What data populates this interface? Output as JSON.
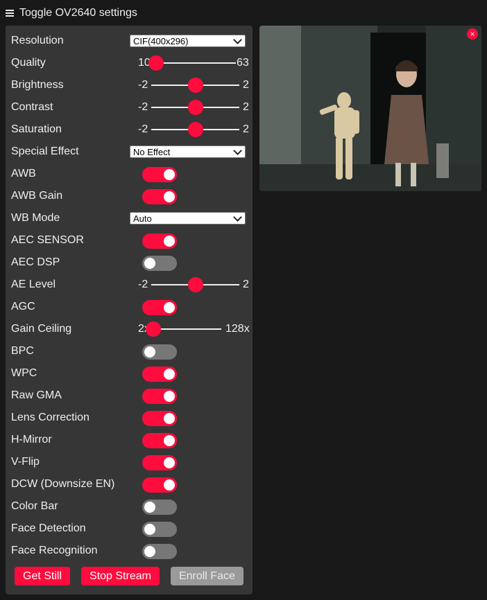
{
  "header": {
    "title": "Toggle OV2640 settings",
    "menu_icon": "hamburger-icon"
  },
  "settings": [
    {
      "type": "select",
      "label": "Resolution",
      "value": "CIF(400x296)"
    },
    {
      "type": "range",
      "label": "Quality",
      "min": "10",
      "max": "63",
      "value": 10
    },
    {
      "type": "range",
      "label": "Brightness",
      "min": "-2",
      "max": "2",
      "value": 0
    },
    {
      "type": "range",
      "label": "Contrast",
      "min": "-2",
      "max": "2",
      "value": 0
    },
    {
      "type": "range",
      "label": "Saturation",
      "min": "-2",
      "max": "2",
      "value": 0
    },
    {
      "type": "select",
      "label": "Special Effect",
      "value": "No Effect"
    },
    {
      "type": "toggle",
      "label": "AWB",
      "on": true
    },
    {
      "type": "toggle",
      "label": "AWB Gain",
      "on": true
    },
    {
      "type": "select",
      "label": "WB Mode",
      "value": "Auto"
    },
    {
      "type": "toggle",
      "label": "AEC SENSOR",
      "on": true
    },
    {
      "type": "toggle",
      "label": "AEC DSP",
      "on": false
    },
    {
      "type": "range",
      "label": "AE Level",
      "min": "-2",
      "max": "2",
      "value": 0
    },
    {
      "type": "toggle",
      "label": "AGC",
      "on": true
    },
    {
      "type": "range",
      "label": "Gain Ceiling",
      "min": "2x",
      "max": "128x",
      "value": 0
    },
    {
      "type": "toggle",
      "label": "BPC",
      "on": false
    },
    {
      "type": "toggle",
      "label": "WPC",
      "on": true
    },
    {
      "type": "toggle",
      "label": "Raw GMA",
      "on": true
    },
    {
      "type": "toggle",
      "label": "Lens Correction",
      "on": true
    },
    {
      "type": "toggle",
      "label": "H-Mirror",
      "on": true
    },
    {
      "type": "toggle",
      "label": "V-Flip",
      "on": true
    },
    {
      "type": "toggle",
      "label": "DCW (Downsize EN)",
      "on": true
    },
    {
      "type": "toggle",
      "label": "Color Bar",
      "on": false
    },
    {
      "type": "toggle",
      "label": "Face Detection",
      "on": false
    },
    {
      "type": "toggle",
      "label": "Face Recognition",
      "on": false
    }
  ],
  "buttons": {
    "get_still": "Get Still",
    "stop_stream": "Stop Stream",
    "enroll_face": "Enroll Face"
  },
  "stream": {
    "close_glyph": "×"
  },
  "colors": {
    "accent": "#ff0c3e",
    "panel": "#363636",
    "background": "#181818",
    "toggle_off": "#777777"
  }
}
